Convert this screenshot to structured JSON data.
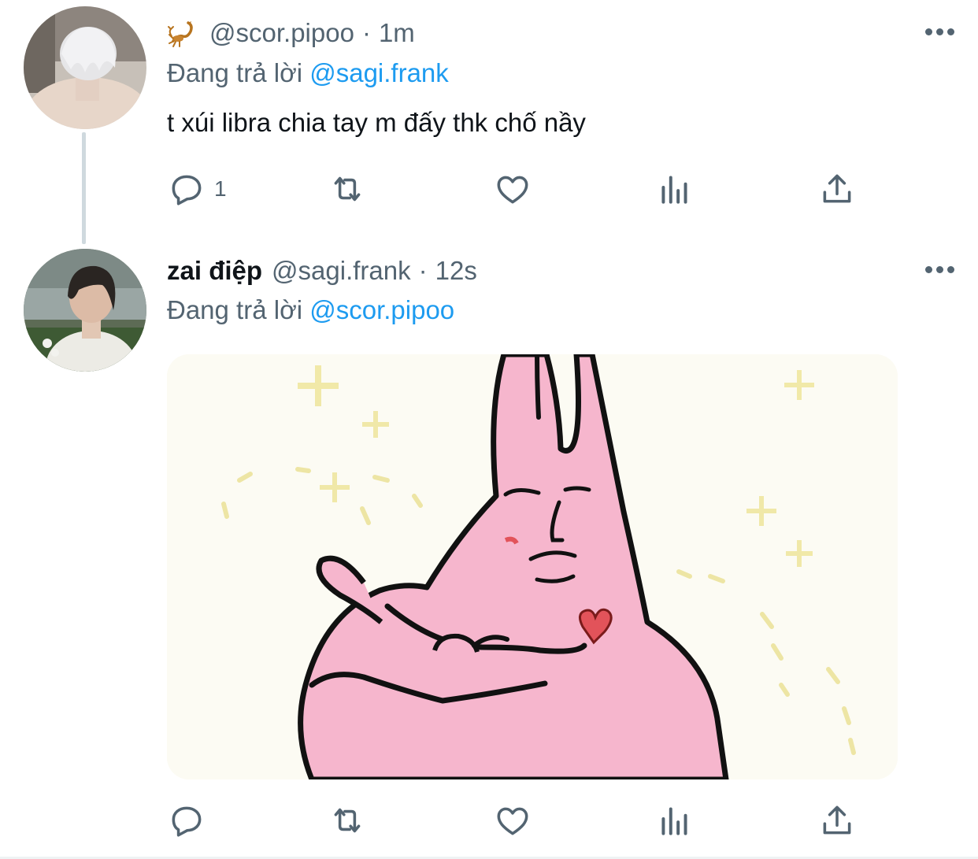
{
  "tweets": [
    {
      "display_name": "",
      "handle": "@scor.pipoo",
      "separator": "·",
      "time": "1m",
      "name_emoji": "scorpion-emoji",
      "replying_prefix": "Đang trả lời",
      "replying_to": "@sagi.frank",
      "text": "t xúi libra chia tay m đấy thk chố nầy",
      "reply_count": "1",
      "has_media": false
    },
    {
      "display_name": "zai điệp",
      "handle": "@sagi.frank",
      "separator": "·",
      "time": "12s",
      "replying_prefix": "Đang trả lời",
      "replying_to": "@scor.pipoo",
      "text": "",
      "reply_count": "",
      "has_media": true
    }
  ],
  "icons": {
    "reply": "reply-bubble-icon",
    "retweet": "retweet-icon",
    "like": "heart-icon",
    "views": "views-bar-chart-icon",
    "share": "share-upload-icon",
    "more": "more-dots-icon"
  },
  "colors": {
    "text_primary": "#0f1419",
    "text_secondary": "#536471",
    "link": "#1d9bf0",
    "thread_line": "#cfd9de",
    "bunny_pink": "#f5b9cf",
    "heart_red": "#e2535a"
  }
}
